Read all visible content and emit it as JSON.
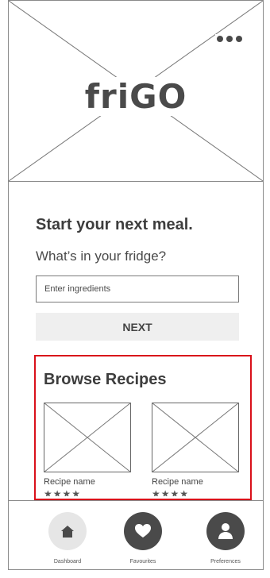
{
  "header": {
    "logo_text": "friGO",
    "more_icon": "more-horizontal-icon"
  },
  "main": {
    "heading": "Start your next meal.",
    "question": "What’s in your fridge?",
    "ingredients_placeholder": "Enter ingredients",
    "next_label": "NEXT"
  },
  "browse": {
    "title": "Browse Recipes",
    "cards": [
      {
        "name": "Recipe name",
        "stars": "★★★★",
        "rating": 4
      },
      {
        "name": "Recipe name",
        "stars": "★★★★",
        "rating": 4
      }
    ],
    "highlight_color": "#d9101a"
  },
  "tabs": [
    {
      "label": "Dashboard",
      "icon": "home-icon",
      "active": false
    },
    {
      "label": "Favourites",
      "icon": "heart-icon",
      "active": true
    },
    {
      "label": "Preferences",
      "icon": "user-icon",
      "active": true
    }
  ],
  "colors": {
    "ink": "#4a4a4a",
    "light_button": "#efefef",
    "tab_circle_light": "#e6e6e6",
    "tab_circle_dark": "#4a4a4a"
  }
}
